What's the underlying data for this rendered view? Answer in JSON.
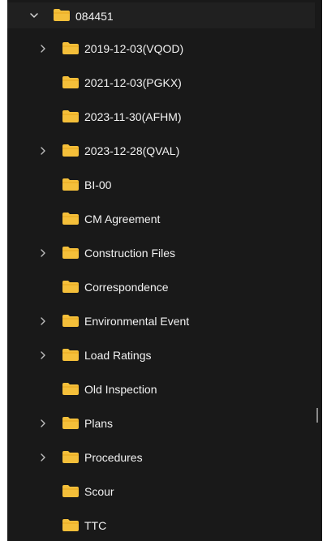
{
  "tree": {
    "root": {
      "label": "084451",
      "expanded": true
    },
    "items": [
      {
        "label": "2019-12-03(VQOD)",
        "expandable": true
      },
      {
        "label": "2021-12-03(PGKX)",
        "expandable": false
      },
      {
        "label": "2023-11-30(AFHM)",
        "expandable": false
      },
      {
        "label": "2023-12-28(QVAL)",
        "expandable": true
      },
      {
        "label": "BI-00",
        "expandable": false
      },
      {
        "label": "CM Agreement",
        "expandable": false
      },
      {
        "label": "Construction Files",
        "expandable": true
      },
      {
        "label": "Correspondence",
        "expandable": false
      },
      {
        "label": "Environmental Event",
        "expandable": true
      },
      {
        "label": "Load Ratings",
        "expandable": true
      },
      {
        "label": "Old Inspection",
        "expandable": false
      },
      {
        "label": "Plans",
        "expandable": true
      },
      {
        "label": "Procedures",
        "expandable": true
      },
      {
        "label": "Scour",
        "expandable": false
      },
      {
        "label": "TTC",
        "expandable": false
      }
    ]
  },
  "icons": {
    "folder": "folder-icon",
    "collapsed": "chevron-right-icon",
    "expanded": "chevron-down-icon"
  },
  "colors": {
    "background": "#191919",
    "selected_row": "#202020",
    "folder": "#f4bf3a",
    "text": "#f2f2f2"
  }
}
